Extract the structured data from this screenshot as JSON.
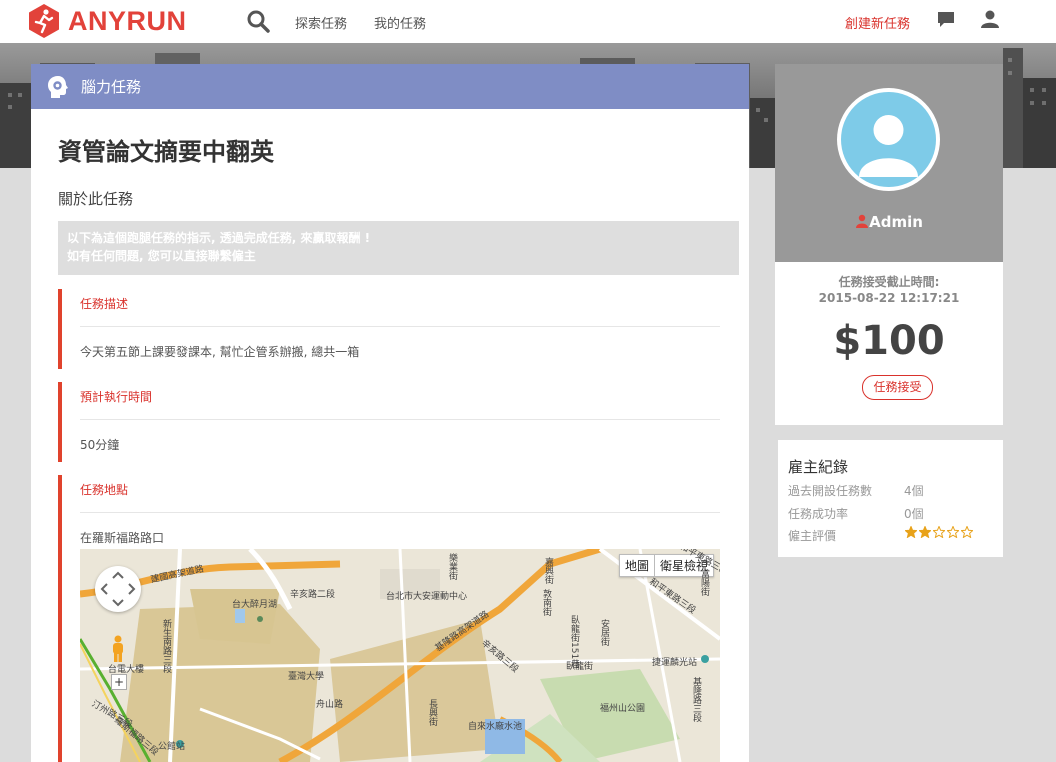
{
  "brand": {
    "name": "ANYRUN",
    "color": "#e2423a"
  },
  "nav": {
    "search_icon": "search-icon",
    "explore": "探索任務",
    "my_tasks": "我的任務",
    "create": "創建新任務",
    "chat_icon": "chat-icon",
    "user_icon": "user-icon"
  },
  "task": {
    "category": "腦力任務",
    "category_color": "#7f8dc5",
    "title": "資管論文摘要中翻英",
    "about": "關於此任務",
    "notice_line1": "以下為這個跑腿任務的指示, 透過完成任務, 來贏取報酬 !",
    "notice_line2": "如有任何問題, 您可以直接聯繫僱主",
    "sections": [
      {
        "label": "任務描述",
        "value": "今天第五節上課要發課本, 幫忙企管系辦搬, 總共一箱"
      },
      {
        "label": "預計執行時間",
        "value": "50分鐘"
      },
      {
        "label": "任務地點",
        "value": "在羅斯福路路口"
      }
    ]
  },
  "map": {
    "type_map": "地圖",
    "type_satellite": "衛星檢視",
    "zoom_in": "+",
    "labels": [
      "建國高架道路",
      "辛亥路二段",
      "台北市大安運動中心",
      "台大醉月湖",
      "臺灣大學",
      "舟山路",
      "基隆路高架道路",
      "臥龍街",
      "福州山公園",
      "自來水廠水池",
      "捷運麟光站",
      "台電大樓",
      "公館站",
      "新生南路三段",
      "汀州路三段",
      "嘉興街",
      "富陽街",
      "和平東路三段",
      "長興街",
      "辛亥路三段",
      "羅斯福路三段",
      "樂業街",
      "敦南街",
      "安居街",
      "和平東路三段87巷",
      "基隆路三段",
      "臥龍街151巷"
    ]
  },
  "poster": {
    "name": "Admin",
    "deadline_label": "任務接受截止時間:",
    "deadline": "2015-08-22 12:17:21",
    "price": "$100",
    "accept": "任務接受"
  },
  "record": {
    "title": "雇主紀錄",
    "rows": [
      {
        "label": "過去開設任務數",
        "value": "4個"
      },
      {
        "label": "任務成功率",
        "value": "0個"
      },
      {
        "label": "僱主評價"
      }
    ],
    "rating": 2,
    "rating_max": 5,
    "star_color": "#e8a21a"
  }
}
